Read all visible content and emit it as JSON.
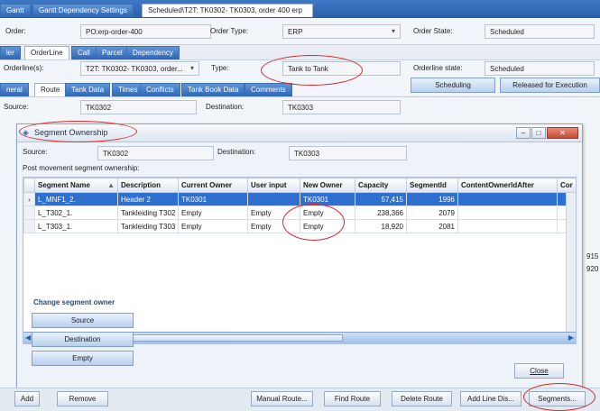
{
  "top_tabs": [
    "Gantt",
    "Gantt Dependency Settings",
    "Scheduled\\T2T: TK0302- TK0303, order 400 erp"
  ],
  "order_section": {
    "order_label": "Order:",
    "order_value": "PO:erp-order-400",
    "order_type_label": "Order Type:",
    "order_type_value": "ERP",
    "order_state_label": "Order State:",
    "order_state_value": "Scheduled"
  },
  "order_tabs": [
    "ler",
    "OrderLine",
    "Call",
    "Parcel",
    "Dependency"
  ],
  "orderline_section": {
    "orderlines_label": "Orderline(s):",
    "orderlines_value": "T2T: TK0302- TK0303, order...",
    "type_label": "Type:",
    "type_value": "Tank to Tank",
    "orderline_state_label": "Orderline state:",
    "orderline_state_value": "Scheduled",
    "scheduling_button": "Scheduling",
    "released_button": "Released for Execution"
  },
  "detail_tabs": [
    "neral",
    "Route",
    "Tank Data",
    "Times",
    "Conflicts",
    "Tank Book Data",
    "Comments"
  ],
  "route_section": {
    "source_label": "Source:",
    "source_value": "TK0302",
    "destination_label": "Destination:",
    "destination_value": "TK0303"
  },
  "dialog": {
    "title": "Segment Ownership",
    "source_label": "Source:",
    "source_value": "TK0302",
    "destination_label": "Destination:",
    "destination_value": "TK0303",
    "post_movement_label": "Post movement segment ownership:",
    "columns": [
      "Segment Name",
      "Description",
      "Current Owner",
      "User input",
      "New Owner",
      "Capacity",
      "SegmentId",
      "ContentOwnerIdAfter",
      "Cor"
    ],
    "rows": [
      [
        "L_MNF1_2.",
        "Header 2",
        "TK0301",
        "",
        "TK0301",
        "57,415",
        "1996",
        "",
        ""
      ],
      [
        "L_T302_1.",
        "Tankleiding T302",
        "Empty",
        "Empty",
        "Empty",
        "238,366",
        "2079",
        "",
        ""
      ],
      [
        "L_T303_1.",
        "Tankleiding T303",
        "Empty",
        "Empty",
        "Empty",
        "18,920",
        "2081",
        "",
        ""
      ]
    ],
    "change_owner_title": "Change segment owner",
    "owner_buttons": [
      "Source",
      "Destination",
      "Empty"
    ],
    "close_button": "Close",
    "side_values": [
      "915",
      "920"
    ]
  },
  "bottom_bar": {
    "add": "Add",
    "remove": "Remove",
    "manual_route": "Manual Route...",
    "find_route": "Find Route",
    "delete_route": "Delete Route",
    "add_line_dis": "Add Line Dis...",
    "segments": "Segments..."
  },
  "colors": {
    "highlight_circle": "#d62a2a",
    "selected_row": "#2f6fd0",
    "tab_blue": "#2e66b5"
  }
}
